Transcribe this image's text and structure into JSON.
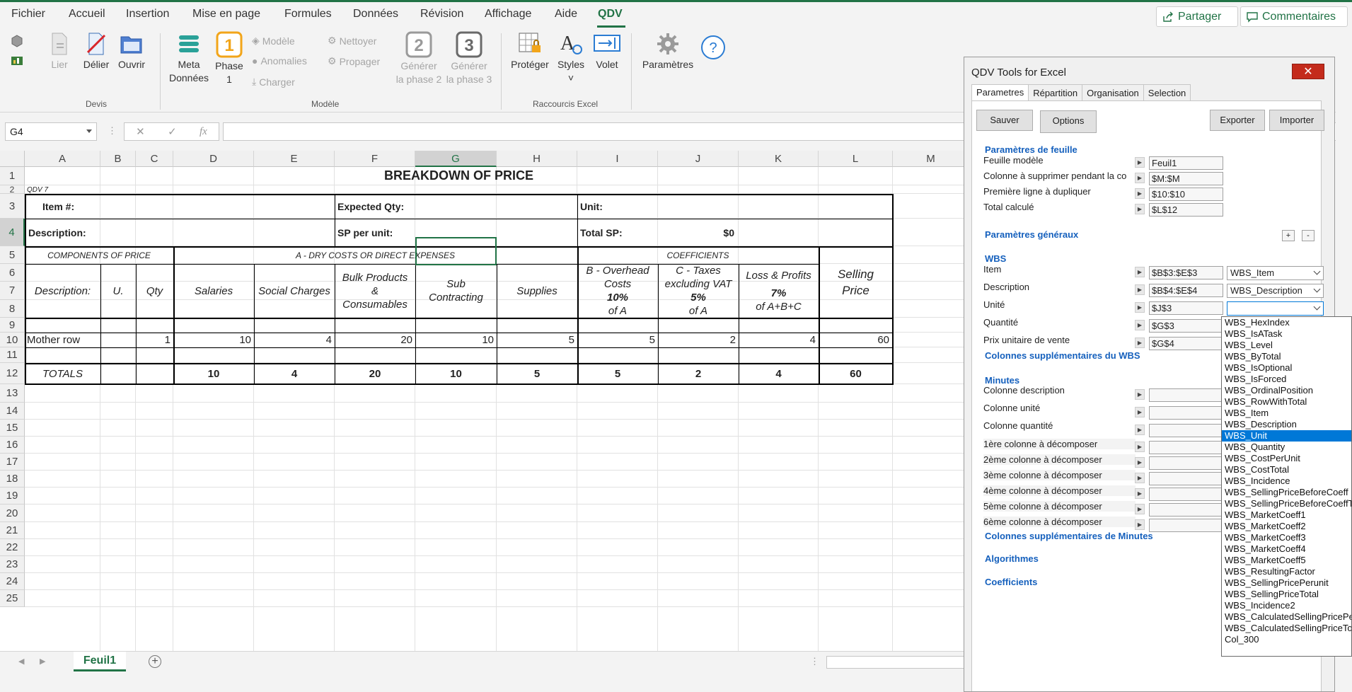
{
  "menu": {
    "items": [
      "Fichier",
      "Accueil",
      "Insertion",
      "Mise en page",
      "Formules",
      "Données",
      "Révision",
      "Affichage",
      "Aide",
      "QDV"
    ],
    "share_label": "Partager",
    "comments_label": "Commentaires"
  },
  "ribbon": {
    "devis": {
      "lier": "Lier",
      "delier": "Délier",
      "ouvrir": "Ouvrir",
      "group_label": "Devis"
    },
    "modele": {
      "meta_l1": "Meta",
      "meta_l2": "Données",
      "phase1_l1": "Phase",
      "phase1_l2": "1",
      "modele_btn": "Modèle",
      "anomalies": "Anomalies",
      "charger": "Charger",
      "nettoyer": "Nettoyer",
      "propager": "Propager",
      "gen2_l1": "Générer",
      "gen2_l2": "la phase 2",
      "gen3_l1": "Générer",
      "gen3_l2": "la phase 3",
      "group_label": "Modèle"
    },
    "raccourcis": {
      "proteger": "Protéger",
      "styles": "Styles",
      "volet": "Volet",
      "group_label": "Raccourcis Excel"
    },
    "parametres": "Paramètres"
  },
  "formula_bar": {
    "name_box": "G4",
    "fx": "fx",
    "formula": ""
  },
  "grid": {
    "columns": [
      "A",
      "B",
      "C",
      "D",
      "E",
      "F",
      "G",
      "H",
      "I",
      "J",
      "K",
      "L",
      "M"
    ],
    "rows": [
      "1",
      "2",
      "3",
      "4",
      "5",
      "6",
      "7",
      "8",
      "9",
      "10",
      "11",
      "12",
      "13",
      "14",
      "15",
      "16",
      "17",
      "18",
      "19",
      "20",
      "21",
      "22",
      "23",
      "24",
      "25"
    ],
    "title": "BREAKDOWN OF PRICE",
    "qdv7": "QDV 7",
    "item_label": "Item #:",
    "expected_qty": "Expected Qty:",
    "unit_label": "Unit:",
    "description_label": "Description:",
    "sp_per_unit": "SP per unit:",
    "total_sp": "Total SP:",
    "total_sp_value": "$0",
    "components": "COMPONENTS OF PRICE",
    "dry_costs": "A - DRY COSTS OR DIRECT EXPENSES",
    "coefficients": "COEFFICIENTS",
    "h_description": "Description:",
    "h_u": "U.",
    "h_qty": "Qty",
    "h_salaries": "Salaries",
    "h_social": "Social Charges",
    "h_bulk_1": "Bulk Products",
    "h_bulk_2": "&",
    "h_bulk_3": "Consumables",
    "h_sub_1": "Sub",
    "h_sub_2": "Contracting",
    "h_supplies": "Supplies",
    "h_b_1": "B - Overhead",
    "h_b_2": "Costs",
    "h_b_pct": "10%",
    "h_b_of": "of A",
    "h_c_1": "C - Taxes",
    "h_c_2": "excluding VAT",
    "h_c_pct": "5%",
    "h_c_of": "of A",
    "h_loss": "Loss & Profits",
    "h_loss_pct": "7%",
    "h_loss_of": "of A+B+C",
    "h_selling_1": "Selling",
    "h_selling_2": "Price",
    "mother_row": {
      "label": "Mother row",
      "qty": "1",
      "salaries": "10",
      "social": "4",
      "bulk": "20",
      "sub": "10",
      "supplies": "5",
      "overhead": "5",
      "taxes": "2",
      "loss": "4",
      "selling": "60"
    },
    "totals": {
      "label": "TOTALS",
      "salaries": "10",
      "social": "4",
      "bulk": "20",
      "sub": "10",
      "supplies": "5",
      "overhead": "5",
      "taxes": "2",
      "loss": "4",
      "selling": "60"
    }
  },
  "sheet_tabs": {
    "active": "Feuil1",
    "add": "+"
  },
  "panel": {
    "title": "QDV Tools for Excel",
    "close": "✕",
    "tabs": [
      "Parametres",
      "Répartition",
      "Organisation",
      "Selection"
    ],
    "buttons": {
      "sauver": "Sauver",
      "options": "Options",
      "exporter": "Exporter",
      "importer": "Importer"
    },
    "sec_feuille": "Paramètres de feuille",
    "feuille_modele": "Feuille modèle",
    "feuille_modele_val": "Feuil1",
    "colonne_supprimer": "Colonne à supprimer pendant la co",
    "colonne_supprimer_val": "$M:$M",
    "premiere_ligne": "Première ligne à dupliquer",
    "premiere_ligne_val": "$10:$10",
    "total_calcule": "Total calculé",
    "total_calcule_val": "$L$12",
    "sec_generaux": "Paramètres généraux",
    "plus": "+",
    "minus": "-",
    "sec_wbs": "WBS",
    "wbs_item": "Item",
    "wbs_item_val": "$B$3:$E$3",
    "wbs_item_combo": "WBS_Item",
    "wbs_desc": "Description",
    "wbs_desc_val": "$B$4:$E$4",
    "wbs_desc_combo": "WBS_Description",
    "wbs_unite": "Unité",
    "wbs_unite_val": "$J$3",
    "wbs_unite_combo": "",
    "wbs_quantite": "Quantité",
    "wbs_quantite_val": "$G$3",
    "wbs_prix": "Prix unitaire de vente",
    "wbs_prix_val": "$G$4",
    "sec_wbs_extra": "Colonnes supplémentaires du WBS",
    "sec_minutes": "Minutes",
    "min_desc": "Colonne description",
    "min_unite": "Colonne unité",
    "min_qty": "Colonne quantité",
    "decomp": [
      "1ère colonne à décomposer",
      "2ème colonne à décomposer",
      "3ème colonne à décomposer",
      "4ème colonne à décomposer",
      "5ème colonne à décomposer",
      "6ème colonne à décomposer"
    ],
    "sec_minutes_extra": "Colonnes supplémentaires de Minutes",
    "sec_algo": "Algorithmes",
    "sec_coeff": "Coefficients"
  },
  "dropdown": {
    "items": [
      "WBS_HexIndex",
      "WBS_IsATask",
      "WBS_Level",
      "WBS_ByTotal",
      "WBS_IsOptional",
      "WBS_IsForced",
      "WBS_OrdinalPosition",
      "WBS_RowWithTotal",
      "WBS_Item",
      "WBS_Description",
      "WBS_Unit",
      "WBS_Quantity",
      "WBS_CostPerUnit",
      "WBS_CostTotal",
      "WBS_Incidence",
      "WBS_SellingPriceBeforeCoeff",
      "WBS_SellingPriceBeforeCoeffT",
      "WBS_MarketCoeff1",
      "WBS_MarketCoeff2",
      "WBS_MarketCoeff3",
      "WBS_MarketCoeff4",
      "WBS_MarketCoeff5",
      "WBS_ResultingFactor",
      "WBS_SellingPricePerunit",
      "WBS_SellingPriceTotal",
      "WBS_Incidence2",
      "WBS_CalculatedSellingPricePe",
      "WBS_CalculatedSellingPriceTo",
      "Col_300"
    ],
    "selected": "WBS_Unit"
  },
  "colors": {
    "excel_green": "#217346",
    "panel_section": "#1560bd",
    "selection_blue": "#0078d7",
    "close_red": "#c42b1c"
  }
}
